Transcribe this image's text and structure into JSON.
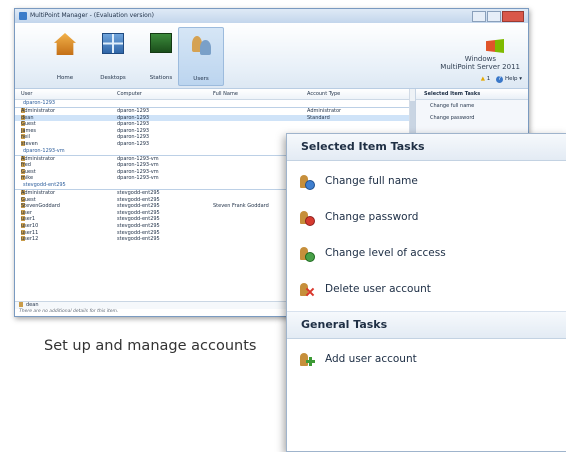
{
  "window": {
    "title": "MultiPoint Manager - (Evaluation version)",
    "ribbon_tabs": [
      {
        "label": "Home",
        "icon": "home-icon"
      },
      {
        "label": "Desktops",
        "icon": "desktops-icon"
      },
      {
        "label": "Stations",
        "icon": "stations-icon"
      },
      {
        "label": "Users",
        "icon": "users-icon"
      }
    ],
    "active_tab": "Users",
    "brand": {
      "line1": "Windows",
      "line2": "MultiPoint Server 2011"
    },
    "alert_count": "1",
    "help_label": "Help"
  },
  "grid": {
    "columns": [
      "User",
      "Computer",
      "Full Name",
      "Account Type"
    ],
    "groups": [
      {
        "name": "dparon-1293",
        "rows": [
          [
            "Administrator",
            "dparon-1293",
            "",
            "Administrator"
          ],
          [
            "dean",
            "dparon-1293",
            "",
            "Standard"
          ],
          [
            "Guest",
            "dparon-1293",
            "",
            ""
          ],
          [
            "james",
            "dparon-1293",
            "",
            ""
          ],
          [
            "neil",
            "dparon-1293",
            "",
            ""
          ],
          [
            "steven",
            "dparon-1293",
            "",
            ""
          ]
        ]
      },
      {
        "name": "dparon-1293-vm",
        "rows": [
          [
            "Administrator",
            "dparon-1293-vm",
            "",
            ""
          ],
          [
            "fred",
            "dparon-1293-vm",
            "",
            ""
          ],
          [
            "Guest",
            "dparon-1293-vm",
            "",
            ""
          ],
          [
            "mike",
            "dparon-1293-vm",
            "",
            ""
          ]
        ]
      },
      {
        "name": "stevgodd-ent295",
        "rows": [
          [
            "Administrator",
            "stevgodd-ent295",
            "",
            ""
          ],
          [
            "Guest",
            "stevgodd-ent295",
            "",
            ""
          ],
          [
            "StevenGoddard",
            "stevgodd-ent295",
            "Steven Frank Goddard",
            ""
          ],
          [
            "user",
            "stevgodd-ent295",
            "",
            ""
          ],
          [
            "user1",
            "stevgodd-ent295",
            "",
            ""
          ],
          [
            "user10",
            "stevgodd-ent295",
            "",
            ""
          ],
          [
            "user11",
            "stevgodd-ent295",
            "",
            ""
          ],
          [
            "user12",
            "stevgodd-ent295",
            "",
            ""
          ]
        ]
      }
    ],
    "selected_user": "dean",
    "details_message": "There are no additional details for this item."
  },
  "side_mini": {
    "header": "Selected Item Tasks",
    "items": [
      "Change full name",
      "Change password"
    ]
  },
  "panel": {
    "selected_header": "Selected Item Tasks",
    "selected_tasks": [
      {
        "label": "Change full name",
        "icon": "user-change-name-icon"
      },
      {
        "label": "Change password",
        "icon": "user-change-password-icon"
      },
      {
        "label": "Change level of access",
        "icon": "user-access-level-icon"
      },
      {
        "label": "Delete user account",
        "icon": "user-delete-icon"
      }
    ],
    "general_header": "General Tasks",
    "general_tasks": [
      {
        "label": "Add user account",
        "icon": "user-add-icon"
      }
    ]
  },
  "caption": "Set up and manage accounts"
}
